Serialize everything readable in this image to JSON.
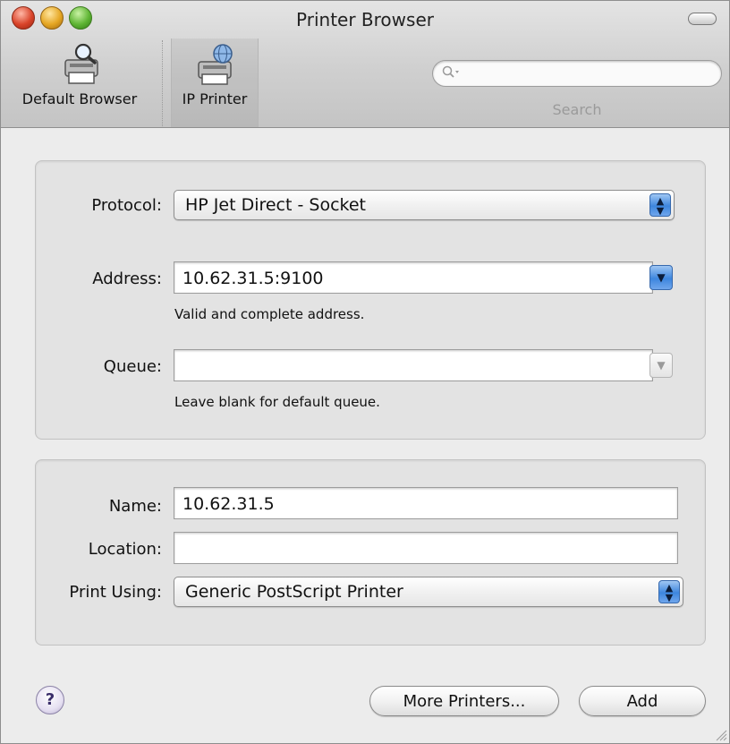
{
  "window": {
    "title": "Printer Browser"
  },
  "toolbar": {
    "items": [
      {
        "label": "Default Browser",
        "icon": "printer-magnifier-icon",
        "selected": false
      },
      {
        "label": "IP Printer",
        "icon": "printer-globe-icon",
        "selected": true
      }
    ],
    "search": {
      "value": "",
      "label": "Search",
      "icon": "magnifier-icon"
    }
  },
  "connection": {
    "protocol": {
      "label": "Protocol:",
      "value": "HP Jet Direct - Socket"
    },
    "address": {
      "label": "Address:",
      "value": "10.62.31.5:9100",
      "hint": "Valid and complete address."
    },
    "queue": {
      "label": "Queue:",
      "value": "",
      "hint": "Leave blank for default queue."
    }
  },
  "details": {
    "name": {
      "label": "Name:",
      "value": "10.62.31.5"
    },
    "location": {
      "label": "Location:",
      "value": ""
    },
    "print_using": {
      "label": "Print Using:",
      "value": "Generic PostScript Printer"
    }
  },
  "buttons": {
    "help": "?",
    "more_printers": "More Printers...",
    "add": "Add"
  },
  "colors": {
    "popup_accent": "#3d86de",
    "window_bg": "#ececec"
  }
}
